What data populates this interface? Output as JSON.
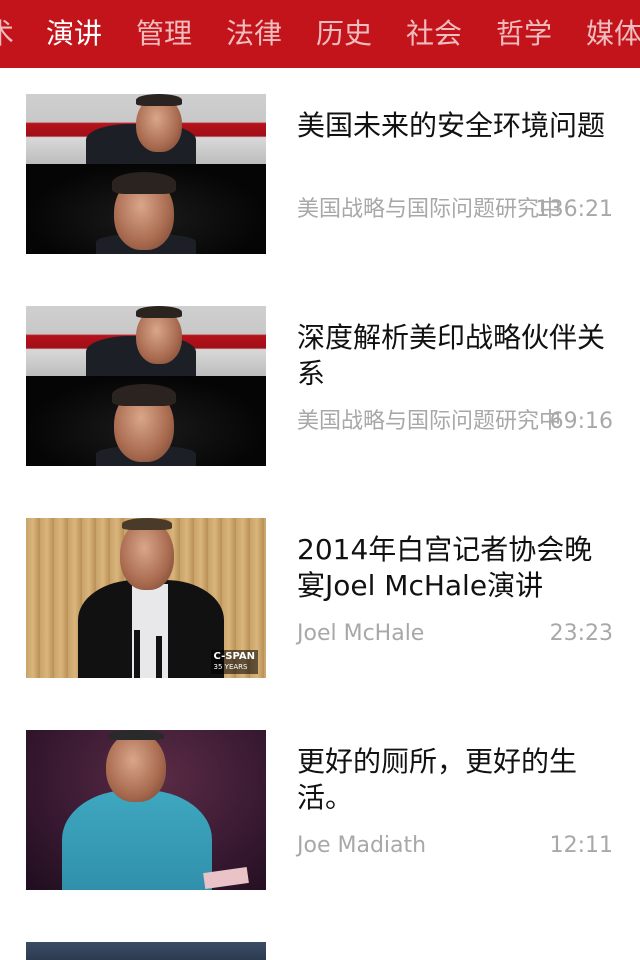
{
  "colors": {
    "header_bg": "#c4141b",
    "tab_active": "#ffffff",
    "tab_inactive": "#f2b9bb",
    "title_text": "#111111",
    "meta_text": "#a8a8a8"
  },
  "tabs": [
    {
      "label": "术",
      "active": false
    },
    {
      "label": "演讲",
      "active": true
    },
    {
      "label": "管理",
      "active": false
    },
    {
      "label": "法律",
      "active": false
    },
    {
      "label": "历史",
      "active": false
    },
    {
      "label": "社会",
      "active": false
    },
    {
      "label": "哲学",
      "active": false
    },
    {
      "label": "媒体",
      "active": false
    }
  ],
  "videos": [
    {
      "title": "美国未来的安全环境问题",
      "author": "美国战略与国际问题研究中",
      "duration": "136:21",
      "thumbnail": "two-speakers-split"
    },
    {
      "title": "深度解析美印战略伙伴关系",
      "author": "美国战略与国际问题研究中",
      "duration": "69:16",
      "thumbnail": "two-speakers-split"
    },
    {
      "title": "2014年白宫记者协会晚宴Joel McHale演讲",
      "author": "Joel McHale",
      "duration": "23:23",
      "thumbnail": "speaker-at-podium",
      "thumbnail_badge": {
        "name": "C-SPAN",
        "sub": "35 YEARS"
      }
    },
    {
      "title": "更好的厕所，更好的生活。",
      "author": "Joe Madiath",
      "duration": "12:11",
      "thumbnail": "speaker-on-stage"
    }
  ]
}
